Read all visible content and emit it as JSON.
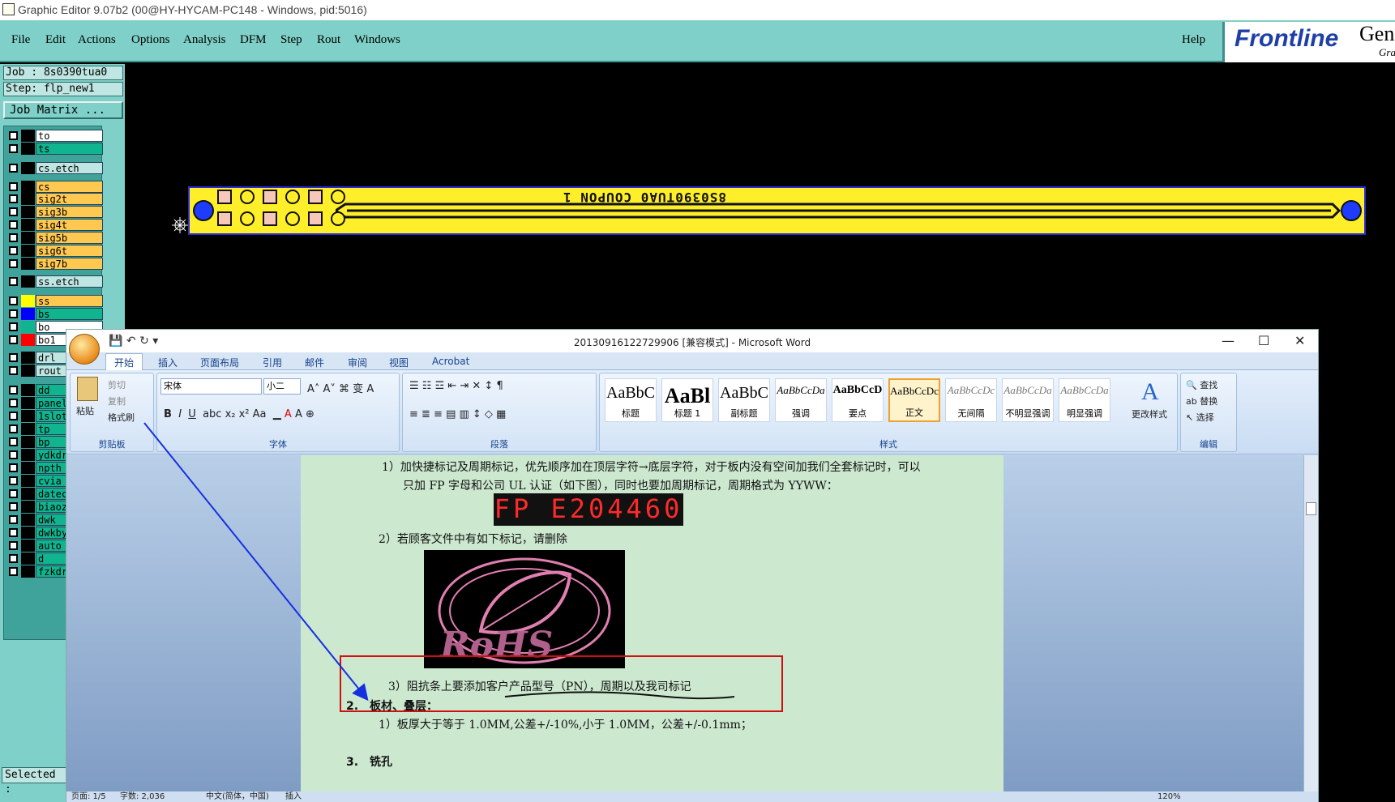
{
  "genesis": {
    "title": "Graphic Editor 9.07b2 (00@HY-HYCAM-PC148 - Windows, pid:5016)",
    "menu": [
      "File",
      "Edit",
      "Actions",
      "Options",
      "Analysis",
      "DFM",
      "Step",
      "Rout",
      "Windows"
    ],
    "help": "Help",
    "brand": "Frontline",
    "brand_sub1": "Gen",
    "brand_sub2": "Gra",
    "job": "Job : 8s0390tua0",
    "step": "Step: flp_new1",
    "job_matrix": "Job Matrix ...",
    "selected": "Selected :",
    "coupon_text": "8S0390TUA0 COUPON 1",
    "layers": [
      {
        "name": "to",
        "color": "#ffffff",
        "swatch": "#000000"
      },
      {
        "name": "ts",
        "color": "#10b48f",
        "swatch": "#000000"
      },
      {
        "name": "cs.etch",
        "color": "#bfe6e2",
        "swatch": "#000000"
      },
      {
        "name": "cs",
        "color": "#ffc850",
        "swatch": "#000000"
      },
      {
        "name": "sig2t",
        "color": "#ffc850",
        "swatch": "#000000"
      },
      {
        "name": "sig3b",
        "color": "#ffc850",
        "swatch": "#000000"
      },
      {
        "name": "sig4t",
        "color": "#ffc850",
        "swatch": "#000000"
      },
      {
        "name": "sig5b",
        "color": "#ffc850",
        "swatch": "#000000"
      },
      {
        "name": "sig6t",
        "color": "#ffc850",
        "swatch": "#000000"
      },
      {
        "name": "sig7b",
        "color": "#ffc850",
        "swatch": "#000000"
      },
      {
        "name": "ss.etch",
        "color": "#bfe6e2",
        "swatch": "#000000"
      },
      {
        "name": "ss",
        "color": "#ffc850",
        "swatch": "#ffff00"
      },
      {
        "name": "bs",
        "color": "#10b48f",
        "swatch": "#0000ff"
      },
      {
        "name": "bo",
        "color": "#ffffff",
        "swatch": "#10b48f"
      },
      {
        "name": "bo1",
        "color": "#ffffff",
        "swatch": "#ff0000"
      },
      {
        "name": "drl",
        "color": "#bfe6e2",
        "swatch": "#000000"
      },
      {
        "name": "rout",
        "color": "#bfe6e2",
        "swatch": "#000000"
      },
      {
        "name": "dd",
        "color": "#10b48f",
        "swatch": "#000000"
      },
      {
        "name": "panel",
        "color": "#10b48f",
        "swatch": "#000000"
      },
      {
        "name": "1slot",
        "color": "#10b48f",
        "swatch": "#000000"
      },
      {
        "name": "tp",
        "color": "#10b48f",
        "swatch": "#000000"
      },
      {
        "name": "bp",
        "color": "#10b48f",
        "swatch": "#000000"
      },
      {
        "name": "ydkdr",
        "color": "#10b48f",
        "swatch": "#000000"
      },
      {
        "name": "npth",
        "color": "#10b48f",
        "swatch": "#000000"
      },
      {
        "name": "cvia",
        "color": "#10b48f",
        "swatch": "#000000"
      },
      {
        "name": "datecc",
        "color": "#10b48f",
        "swatch": "#000000"
      },
      {
        "name": "biaoz",
        "color": "#10b48f",
        "swatch": "#000000"
      },
      {
        "name": "dwk",
        "color": "#10b48f",
        "swatch": "#000000"
      },
      {
        "name": "dwkby",
        "color": "#10b48f",
        "swatch": "#000000"
      },
      {
        "name": "auto_",
        "color": "#10b48f",
        "swatch": "#000000"
      },
      {
        "name": "d",
        "color": "#10b48f",
        "swatch": "#000000"
      },
      {
        "name": "fzkdr",
        "color": "#10b48f",
        "swatch": "#000000"
      }
    ]
  },
  "word": {
    "title": "20130916122729906 [兼容模式] - Microsoft Word",
    "tabs": [
      "开始",
      "插入",
      "页面布局",
      "引用",
      "邮件",
      "审阅",
      "视图",
      "Acrobat"
    ],
    "clipboard": {
      "paste": "粘贴",
      "cut": "剪切",
      "copy": "复制",
      "format_painter": "格式刷",
      "label": "剪贴板"
    },
    "font": {
      "name": "宋体",
      "size": "小二",
      "label": "字体"
    },
    "paragraph_label": "段落",
    "styles_label": "样式",
    "styles": [
      {
        "preview": "AaBbC",
        "name": "标题"
      },
      {
        "preview": "AaBl",
        "name": "标题 1"
      },
      {
        "preview": "AaBbC",
        "name": "副标题"
      },
      {
        "preview": "AaBbCcDa",
        "name": "强调"
      },
      {
        "preview": "AaBbCcD",
        "name": "要点"
      },
      {
        "preview": "AaBbCcDc",
        "name": "正文"
      },
      {
        "preview": "AaBbCcDc",
        "name": "无间隔"
      },
      {
        "preview": "AaBbCcDa",
        "name": "不明显强调"
      },
      {
        "preview": "AaBbCcDa",
        "name": "明显强调"
      }
    ],
    "change_styles": "更改样式",
    "editing": {
      "find": "查找",
      "replace": "替换",
      "select": "选择",
      "label": "编辑"
    },
    "doc": {
      "line1": "1）加快捷标记及周期标记，优先顺序加在顶层字符→底层字符，对于板内没有空间加我们全套标记时，可以",
      "line2": "只加 FP 字母和公司 UL 认证（如下图），同时也要加周期标记，周期格式为 YYWW：",
      "fp_mark": "FP E204460",
      "line3": "2）若顾客文件中有如下标记，请删除",
      "rohs": "RoHS",
      "line4": "3）阻抗条上要添加客户产品型号（PN），周期以及我司标记",
      "line5": "2.　板材、叠层：",
      "line6": "1）板厚大于等于 1.0MM,公差+/-10%,小于 1.0MM，公差+/-0.1mm；",
      "line7": "3.　铣孔"
    },
    "status": {
      "page": "页面: 1/5",
      "words": "字数: 2,036",
      "lang": "中文(简体，中国)",
      "insert": "插入",
      "zoom": "120%"
    }
  }
}
